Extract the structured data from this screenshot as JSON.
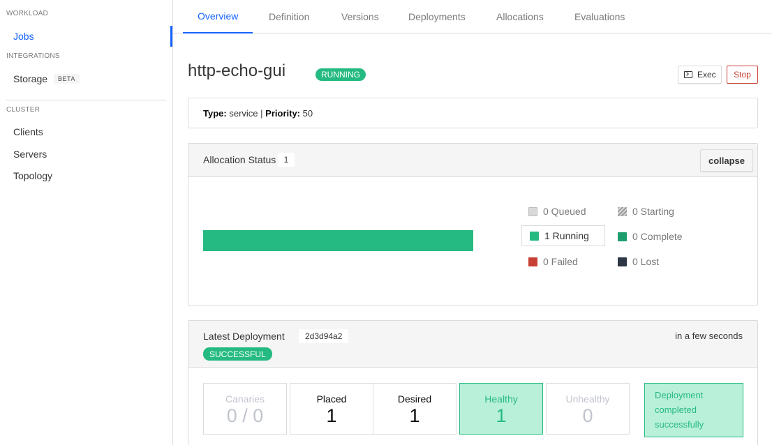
{
  "sidebar": {
    "workload_heading": "WORKLOAD",
    "jobs": "Jobs",
    "integrations_heading": "INTEGRATIONS",
    "storage": "Storage",
    "storage_badge": "BETA",
    "cluster_heading": "CLUSTER",
    "clients": "Clients",
    "servers": "Servers",
    "topology": "Topology"
  },
  "tabs": [
    "Overview",
    "Definition",
    "Versions",
    "Deployments",
    "Allocations",
    "Evaluations"
  ],
  "job": {
    "name": "http-echo-gui",
    "status": "RUNNING",
    "exec_label": "Exec",
    "stop_label": "Stop",
    "type_label": "Type:",
    "type_value": "service",
    "separator": "|",
    "priority_label": "Priority:",
    "priority_value": "50"
  },
  "allocation_status": {
    "title": "Allocation Status",
    "count": "1",
    "collapse_label": "collapse",
    "running_fraction": 1.0,
    "legend": {
      "queued": "0 Queued",
      "starting": "0 Starting",
      "running": "1 Running",
      "complete": "0 Complete",
      "failed": "0 Failed",
      "lost": "0 Lost"
    }
  },
  "latest_deployment": {
    "title": "Latest Deployment",
    "id": "2d3d94a2",
    "time": "in a few seconds",
    "status": "SUCCESSFUL",
    "metrics": {
      "canaries_label": "Canaries",
      "canaries_value": "0 / 0",
      "placed_label": "Placed",
      "placed_value": "1",
      "desired_label": "Desired",
      "desired_value": "1",
      "healthy_label": "Healthy",
      "healthy_value": "1",
      "unhealthy_label": "Unhealthy",
      "unhealthy_value": "0"
    },
    "message": "Deployment completed successfully"
  },
  "colors": {
    "accent": "#1563ff",
    "running": "#25ba81",
    "complete": "#1e9d6e",
    "failed": "#c84034",
    "lost": "#2d3645",
    "queued": "#d9d9d9"
  }
}
